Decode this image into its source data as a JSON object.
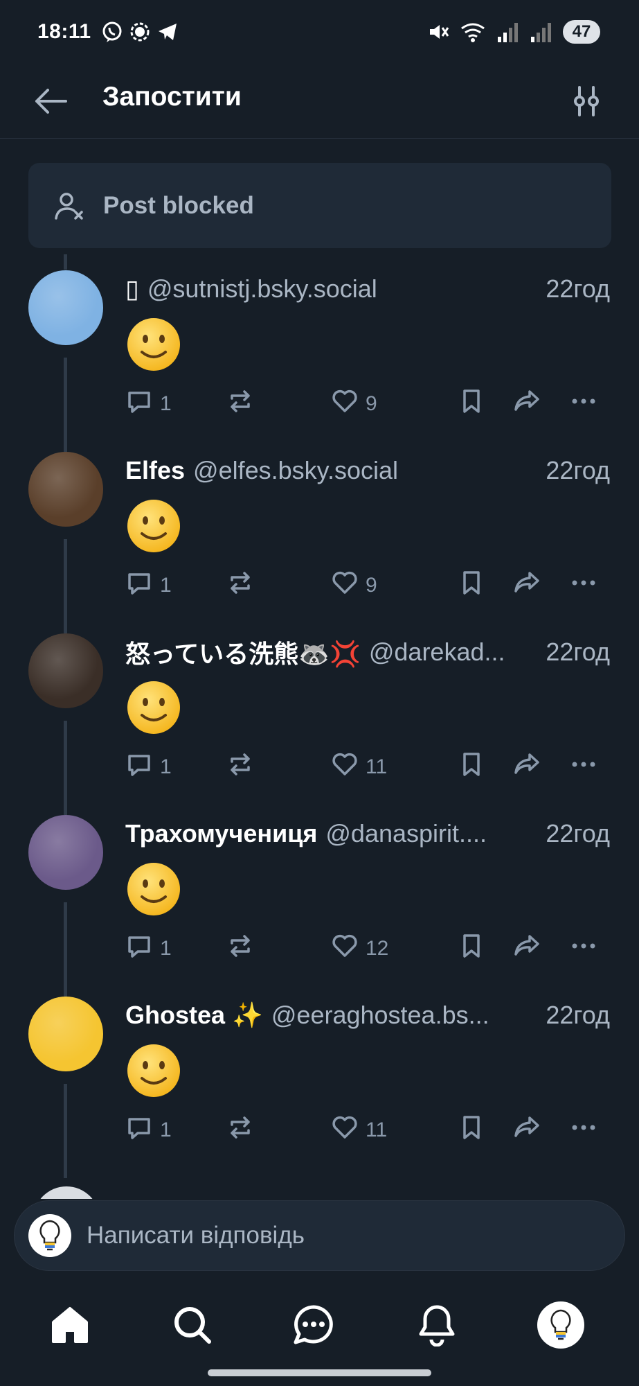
{
  "status_bar": {
    "time": "18:11",
    "battery": "47"
  },
  "header": {
    "title": "Запостити"
  },
  "blocked_notice": {
    "text": "Post blocked"
  },
  "posts": [
    {
      "name": "▯",
      "handle": "@sutnistj.bsky.social",
      "time": "22год",
      "emoji": "🙂",
      "replies": "1",
      "likes": "9",
      "avatar_color": "#7fb2e3"
    },
    {
      "name": "Elfes",
      "handle": "@elfes.bsky.social",
      "time": "22год",
      "emoji": "🙂",
      "replies": "1",
      "likes": "9",
      "avatar_color": "#5a3f2a"
    },
    {
      "name": "怒っている洗熊🦝💢",
      "handle": "@darekad...",
      "time": "22год",
      "emoji": "🙂",
      "replies": "1",
      "likes": "11",
      "avatar_color": "#3a2e27"
    },
    {
      "name": "Трахомучениця",
      "handle": "@danaspirit....",
      "time": "22год",
      "emoji": "🙂",
      "replies": "1",
      "likes": "12",
      "avatar_color": "#6b5a8a"
    },
    {
      "name": "Ghostea ✨",
      "handle": "@eeraghostea.bs...",
      "time": "22год",
      "emoji": "🙂",
      "replies": "1",
      "likes": "11",
      "avatar_color": "#f5c531"
    }
  ],
  "reply_bar": {
    "placeholder": "Написати відповідь"
  },
  "tabs": [
    "home",
    "search",
    "chat",
    "notifications",
    "profile"
  ],
  "colors": {
    "background": "#161e27",
    "card": "#1f2a37",
    "muted": "#8a99ab"
  }
}
